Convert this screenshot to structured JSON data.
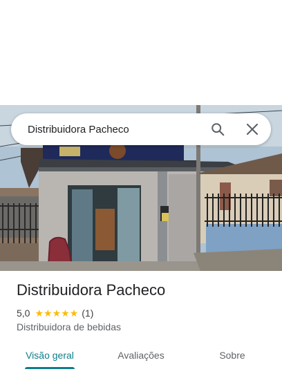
{
  "search": {
    "query": "Distribuidora Pacheco",
    "search_icon": "search-icon",
    "close_icon": "close-icon"
  },
  "place": {
    "name": "Distribuidora Pacheco",
    "rating": "5,0",
    "stars": 5,
    "review_count": "(1)",
    "category": "Distribuidora de bebidas"
  },
  "tabs": [
    {
      "label": "Visão geral",
      "active": true
    },
    {
      "label": "Avaliações",
      "active": false
    },
    {
      "label": "Sobre",
      "active": false
    }
  ],
  "colors": {
    "accent": "#0b7e8c",
    "star": "#fbbc04"
  }
}
